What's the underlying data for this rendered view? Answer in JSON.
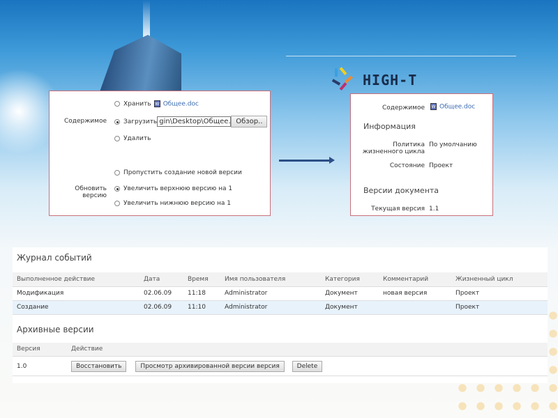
{
  "logo": {
    "text": "HIGH-T"
  },
  "edit_form": {
    "content_label": "Содержимое",
    "keep_label": "Хранить",
    "keep_file": "Общее.doc",
    "upload_label": "Загрузить",
    "upload_value": "gin\\Desktop\\Общее.doc",
    "browse_label": "Обзор..",
    "delete_label": "Удалить",
    "update_label": "Обновить версию",
    "options": [
      "Пропустить создание новой версии",
      "Увеличить верхнюю версию на 1",
      "Увеличить нижнюю версию на 1"
    ],
    "selected_content": "Загрузить",
    "selected_option": "Увеличить верхнюю версию на 1"
  },
  "result": {
    "content_label": "Содержимое",
    "content_file": "Общее.doc",
    "info_title": "Информация",
    "policy_label_1": "Политика",
    "policy_label_2": "жизненного цикла",
    "policy_value": "По умолчанию",
    "state_label": "Состояние",
    "state_value": "Проект",
    "versions_title": "Версии документа",
    "current_label": "Текущая версия",
    "current_value": "1.1"
  },
  "journal": {
    "title": "Журнал событий",
    "columns": [
      "Выполненное действие",
      "Дата",
      "Время",
      "Имя пользователя",
      "Категория",
      "Комментарий",
      "Жизненный цикл"
    ],
    "rows": [
      [
        "Модификация",
        "02.06.09",
        "11:18",
        "Administrator",
        "Документ",
        "новая версия",
        "Проект"
      ],
      [
        "Создание",
        "02.06.09",
        "11:10",
        "Administrator",
        "Документ",
        "",
        "Проект"
      ]
    ]
  },
  "archive": {
    "title": "Архивные версии",
    "columns": [
      "Версия",
      "Действие"
    ],
    "version": "1.0",
    "restore_label": "Восстановить",
    "view_label": "Просмотр архивированной версии версия",
    "delete_label": "Delete"
  }
}
